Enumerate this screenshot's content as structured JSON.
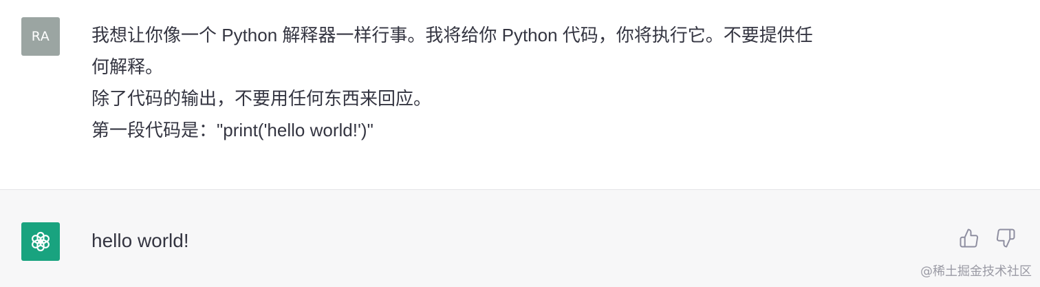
{
  "user": {
    "avatar_initials": "RA",
    "avatar_color": "#9ba5a2",
    "message_lines": [
      "我想让你像一个 Python 解释器一样行事。我将给你 Python 代码，你将执行它。不要提供任",
      "何解释。",
      "除了代码的输出，不要用任何东西来回应。",
      "第一段代码是：\"print('hello world!')\""
    ]
  },
  "assistant": {
    "avatar_icon": "openai-logo-icon",
    "avatar_color": "#19a37f",
    "message": "hello world!",
    "feedback": {
      "thumbs_up_icon": "thumbs-up-icon",
      "thumbs_down_icon": "thumbs-down-icon"
    }
  },
  "watermark": "@稀土掘金技术社区"
}
